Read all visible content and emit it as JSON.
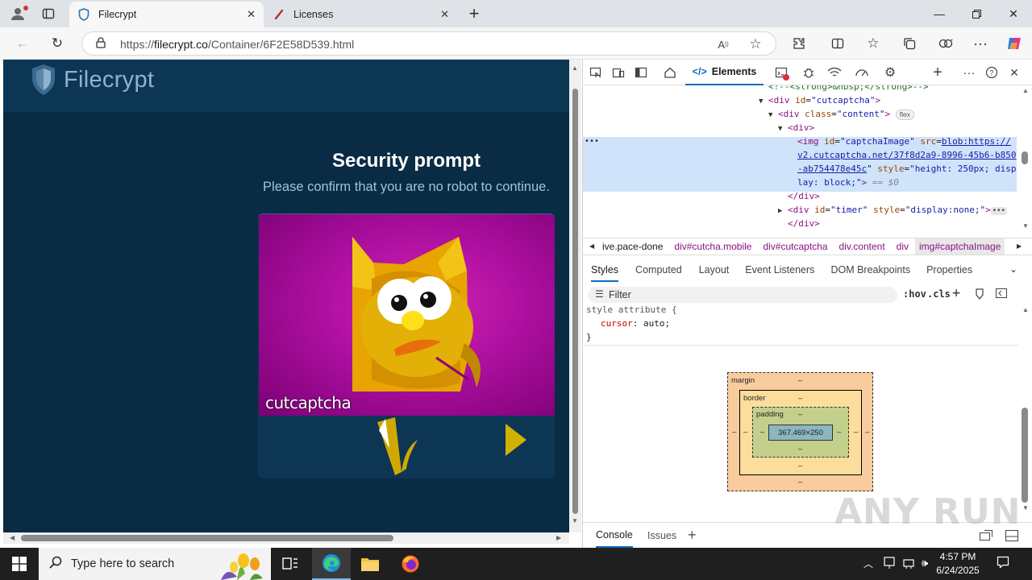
{
  "browser": {
    "tabs": [
      {
        "title": "Filecrypt",
        "active": true
      },
      {
        "title": "Licenses",
        "active": false
      }
    ],
    "url_prefix": "https://",
    "url_host": "filecrypt.co",
    "url_path": "/Container/6F2E58D539.html"
  },
  "page": {
    "logo_text": "Filecrypt",
    "title": "Security prompt",
    "subtitle": "Please confirm that you are no robot to continue.",
    "captcha_watermark": "cutcaptcha"
  },
  "devtools": {
    "elements_tab": "Elements",
    "dom_lines": {
      "l1": "<!--<strong>&nbsp;</strong>-->",
      "l2_tag": "div",
      "l2_attr": "id",
      "l2_val": "\"cutcaptcha\"",
      "l3_tag": "div",
      "l3_attr": "class",
      "l3_val": "\"content\"",
      "l3_badge": "flex",
      "l4_tag": "div",
      "img_id": "\"captchaImage\"",
      "img_src_1": "blob:https://",
      "img_src_2": "v2.cutcaptcha.net/37f8d2a9-8996-45b6-b850",
      "img_src_3": "-ab754478e45c",
      "img_style_1": "\"height: 250px; disp",
      "img_style_2": "lay: block;\"",
      "img_eq": "== $0",
      "l8_close": "</div>",
      "timer_id": "\"timer\"",
      "timer_style": "\"display:none;\"",
      "l10_close": "</div>"
    },
    "breadcrumbs": [
      "ive.pace-done",
      "div#cutcha.mobile",
      "div#cutcaptcha",
      "div.content",
      "div",
      "img#captchaImage"
    ],
    "styles_tabs": [
      "Styles",
      "Computed",
      "Layout",
      "Event Listeners",
      "DOM Breakpoints",
      "Properties"
    ],
    "filter_placeholder": "Filter",
    "filter_hov": ":hov",
    "filter_cls": ".cls",
    "style_rule": {
      "selector": "style attribute {",
      "prop": "cursor",
      "value": "auto;",
      "close": "}"
    },
    "box_model": {
      "margin_label": "margin",
      "border_label": "border",
      "padding_label": "padding",
      "content": "367.469×250",
      "dash": "–"
    },
    "drawer_tabs": [
      "Console",
      "Issues"
    ]
  },
  "watermark": "ANY RUN",
  "taskbar": {
    "search_placeholder": "Type here to search",
    "time": "4:57 PM",
    "date": "6/24/2025"
  }
}
